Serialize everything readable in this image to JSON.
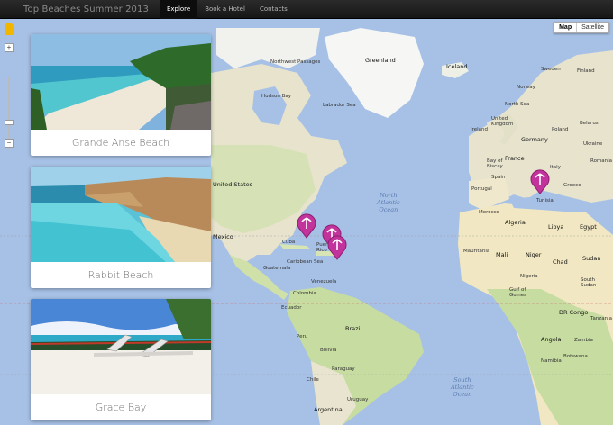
{
  "nav": {
    "brand": "Top Beaches Summer 2013",
    "items": [
      {
        "label": "Explore",
        "active": true
      },
      {
        "label": "Book a Hotel",
        "active": false
      },
      {
        "label": "Contacts",
        "active": false
      }
    ]
  },
  "map_controls": {
    "map_label": "Map",
    "satellite_label": "Satellite",
    "zoom_in": "+",
    "zoom_out": "−"
  },
  "beaches": [
    {
      "name": "Grande Anse Beach"
    },
    {
      "name": "Rabbit Beach"
    },
    {
      "name": "Grace Bay"
    }
  ],
  "labels": {
    "northwest_passages": "Northwest Passages",
    "greenland": "Greenland",
    "iceland": "Iceland",
    "hudson_bay": "Hudson Bay",
    "labrador_sea": "Labrador Sea",
    "united_states": "United States",
    "mexico": "Mexico",
    "cuba": "Cuba",
    "caribbean_sea": "Caribbean Sea",
    "guatemala": "Guatemala",
    "venezuela": "Venezuela",
    "colombia": "Colombia",
    "ecuador": "Ecuador",
    "peru": "Peru",
    "brazil": "Brazil",
    "bolivia": "Bolivia",
    "paraguay": "Paraguay",
    "chile": "Chile",
    "argentina": "Argentina",
    "uruguay": "Uruguay",
    "north_atlantic_ocean": "North\nAtlantic\nOcean",
    "south_atlantic_ocean": "South\nAtlantic\nOcean",
    "sweden": "Sweden",
    "finland": "Finland",
    "norway": "Norway",
    "north_sea": "North Sea",
    "united_kingdom": "United\nKingdom",
    "ireland": "Ireland",
    "germany": "Germany",
    "poland": "Poland",
    "belarus": "Belarus",
    "ukraine": "Ukraine",
    "france": "France",
    "spain": "Spain",
    "portugal": "Portugal",
    "italy": "Italy",
    "romania": "Romania",
    "greece": "Greece",
    "bay_of_biscay": "Bay of\nBiscay",
    "tunisia": "Tunisia",
    "morocco": "Morocco",
    "algeria": "Algeria",
    "libya": "Libya",
    "egypt": "Egypt",
    "mauritania": "Mauritania",
    "mali": "Mali",
    "niger": "Niger",
    "chad": "Chad",
    "sudan": "Sudan",
    "nigeria": "Nigeria",
    "gulf_of_guinea": "Gulf of\nGuinea",
    "dr_congo": "DR Congo",
    "angola": "Angola",
    "zambia": "Zambia",
    "namibia": "Namibia",
    "botswana": "Botswana",
    "south_sudan": "South\nSudan",
    "tanzania": "Tanzania",
    "puerto_rico": "Puerto\nRico"
  },
  "colors": {
    "ocean": "#a7c1e6",
    "land": "#e9e4cf",
    "forest": "#c9dca4",
    "ice": "#f7f7f7",
    "desert": "#f2e7c0",
    "marker": "#c2339b",
    "nav_bg": "#1e1e1e"
  }
}
